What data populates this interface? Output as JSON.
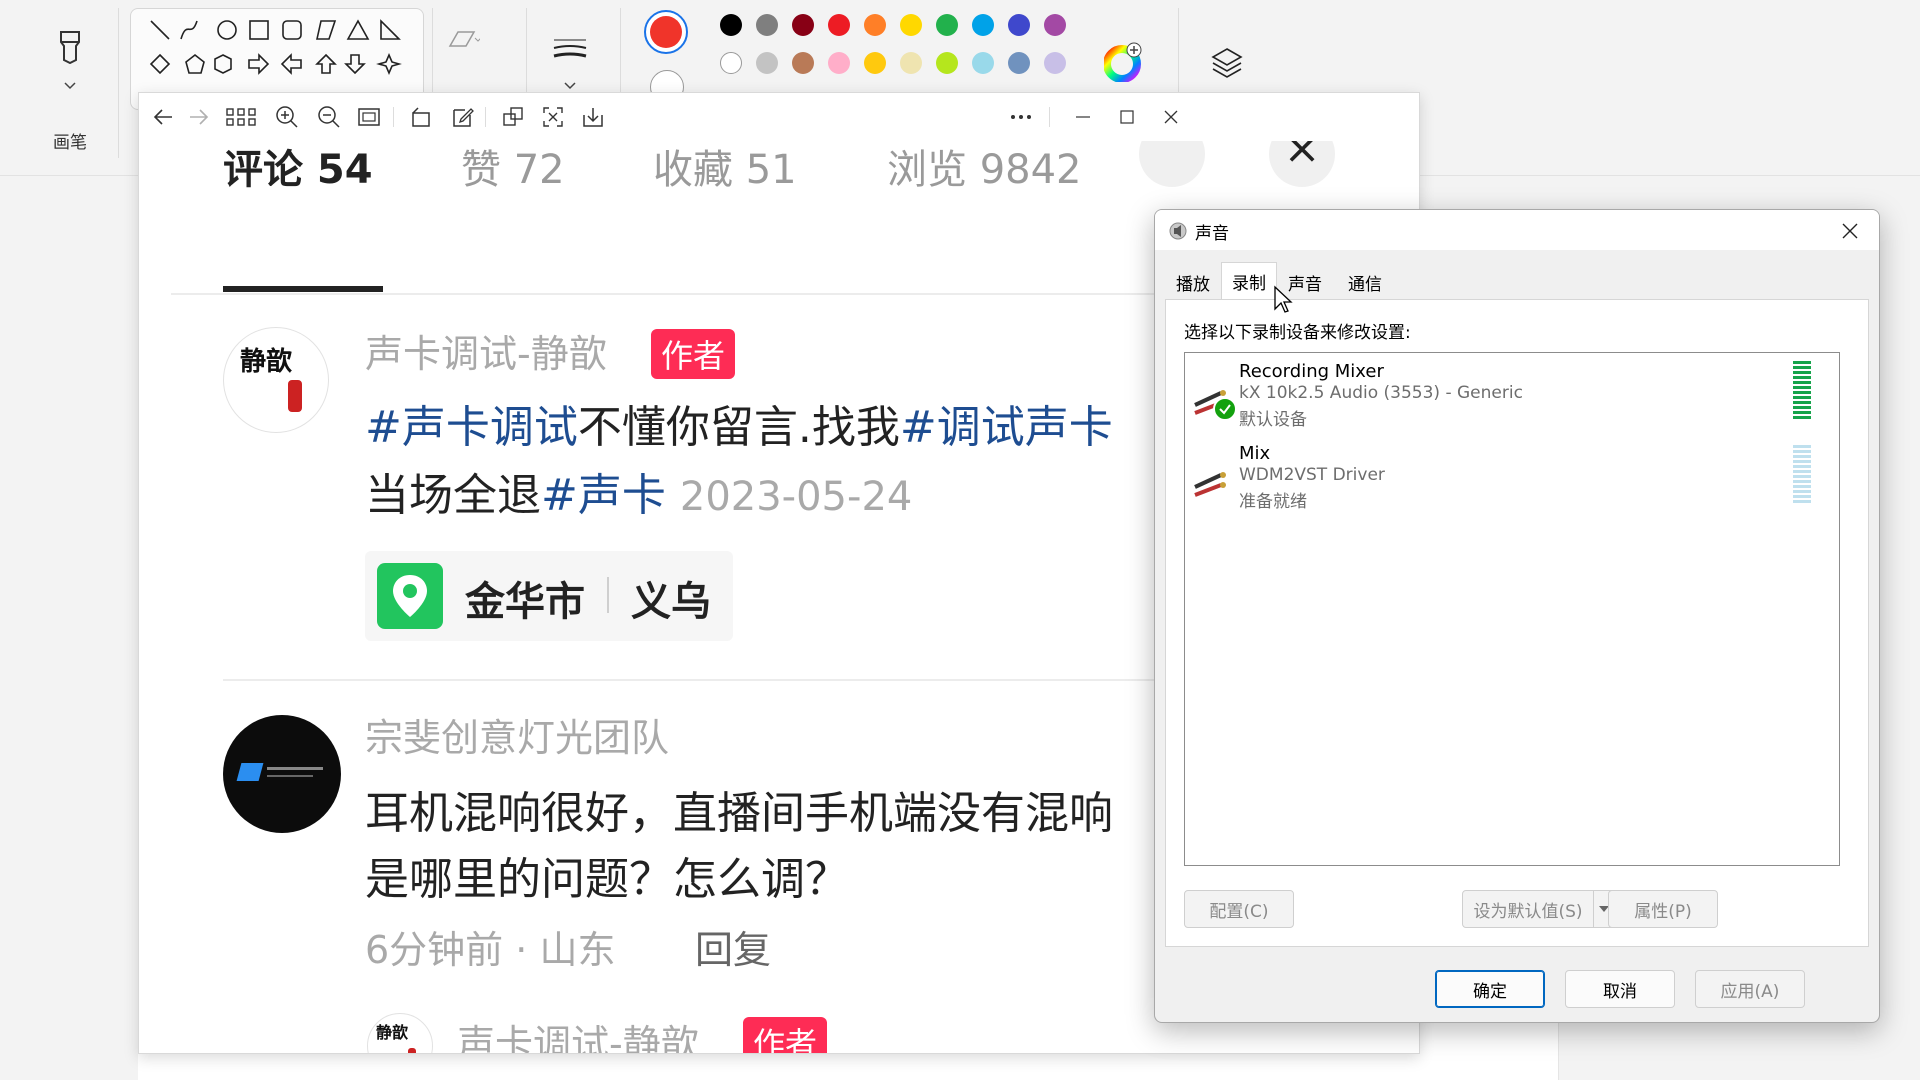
{
  "ribbon": {
    "brush_label": "画笔",
    "primary_color": "#f0342a",
    "secondary_color": "#ffffff",
    "palette_row1": [
      "#000000",
      "#7f7f7f",
      "#880015",
      "#ed1c24",
      "#ff7f27",
      "#ffd800",
      "#22b14c",
      "#00a2e8",
      "#3f48cc",
      "#a349a4"
    ],
    "palette_row2": [
      "#ffffff",
      "#c3c3c3",
      "#b97a57",
      "#ffaec9",
      "#ffc90e",
      "#efe4b0",
      "#b5e61d",
      "#99d9ea",
      "#7092be",
      "#c8bfe7"
    ]
  },
  "viewer": {
    "header": {
      "comments": "评论 54",
      "likes": "赞 72",
      "favorites": "收藏 51",
      "views": "浏览 9842",
      "close_glyph": "×"
    },
    "comment1": {
      "author": "声卡调试-静歆",
      "badge": "作者",
      "avatar_text": "静歆",
      "tag1": "#声卡调试",
      "text1": "不懂你留言.找我",
      "tag2": "#调试声卡",
      "line2_prefix": "当场全退",
      "tag3": "#声卡",
      "date": "2023-05-24",
      "location_city": "金华市",
      "location_district": "义乌"
    },
    "comment2": {
      "author": "宗斐创意灯光团队",
      "line1": "耳机混响很好，直播间手机端没有混响",
      "line2": "是哪里的问题？怎么调？",
      "time": "6分钟前",
      "region": "山东",
      "reply": "回复"
    },
    "comment3": {
      "author": "声卡调试-静歆",
      "badge": "作者"
    }
  },
  "sound_dialog": {
    "title": "声音",
    "tabs": [
      {
        "label": "播放"
      },
      {
        "label": "录制"
      },
      {
        "label": "声音"
      },
      {
        "label": "通信"
      }
    ],
    "active_tab": "录制",
    "instruction": "选择以下录制设备来修改设置:",
    "devices": [
      {
        "name": "Recording Mixer",
        "driver": "kX 10k2.5 Audio (3553) - Generic",
        "status": "默认设备",
        "level": 1.0,
        "is_default": true
      },
      {
        "name": "Mix",
        "driver": "WDM2VST Driver",
        "status": "准备就绪",
        "level": 0.0,
        "is_default": false
      }
    ],
    "buttons": {
      "configure": "配置(C)",
      "set_default": "设为默认值(S)",
      "properties": "属性(P)",
      "ok": "确定",
      "cancel": "取消",
      "apply": "应用(A)"
    }
  }
}
